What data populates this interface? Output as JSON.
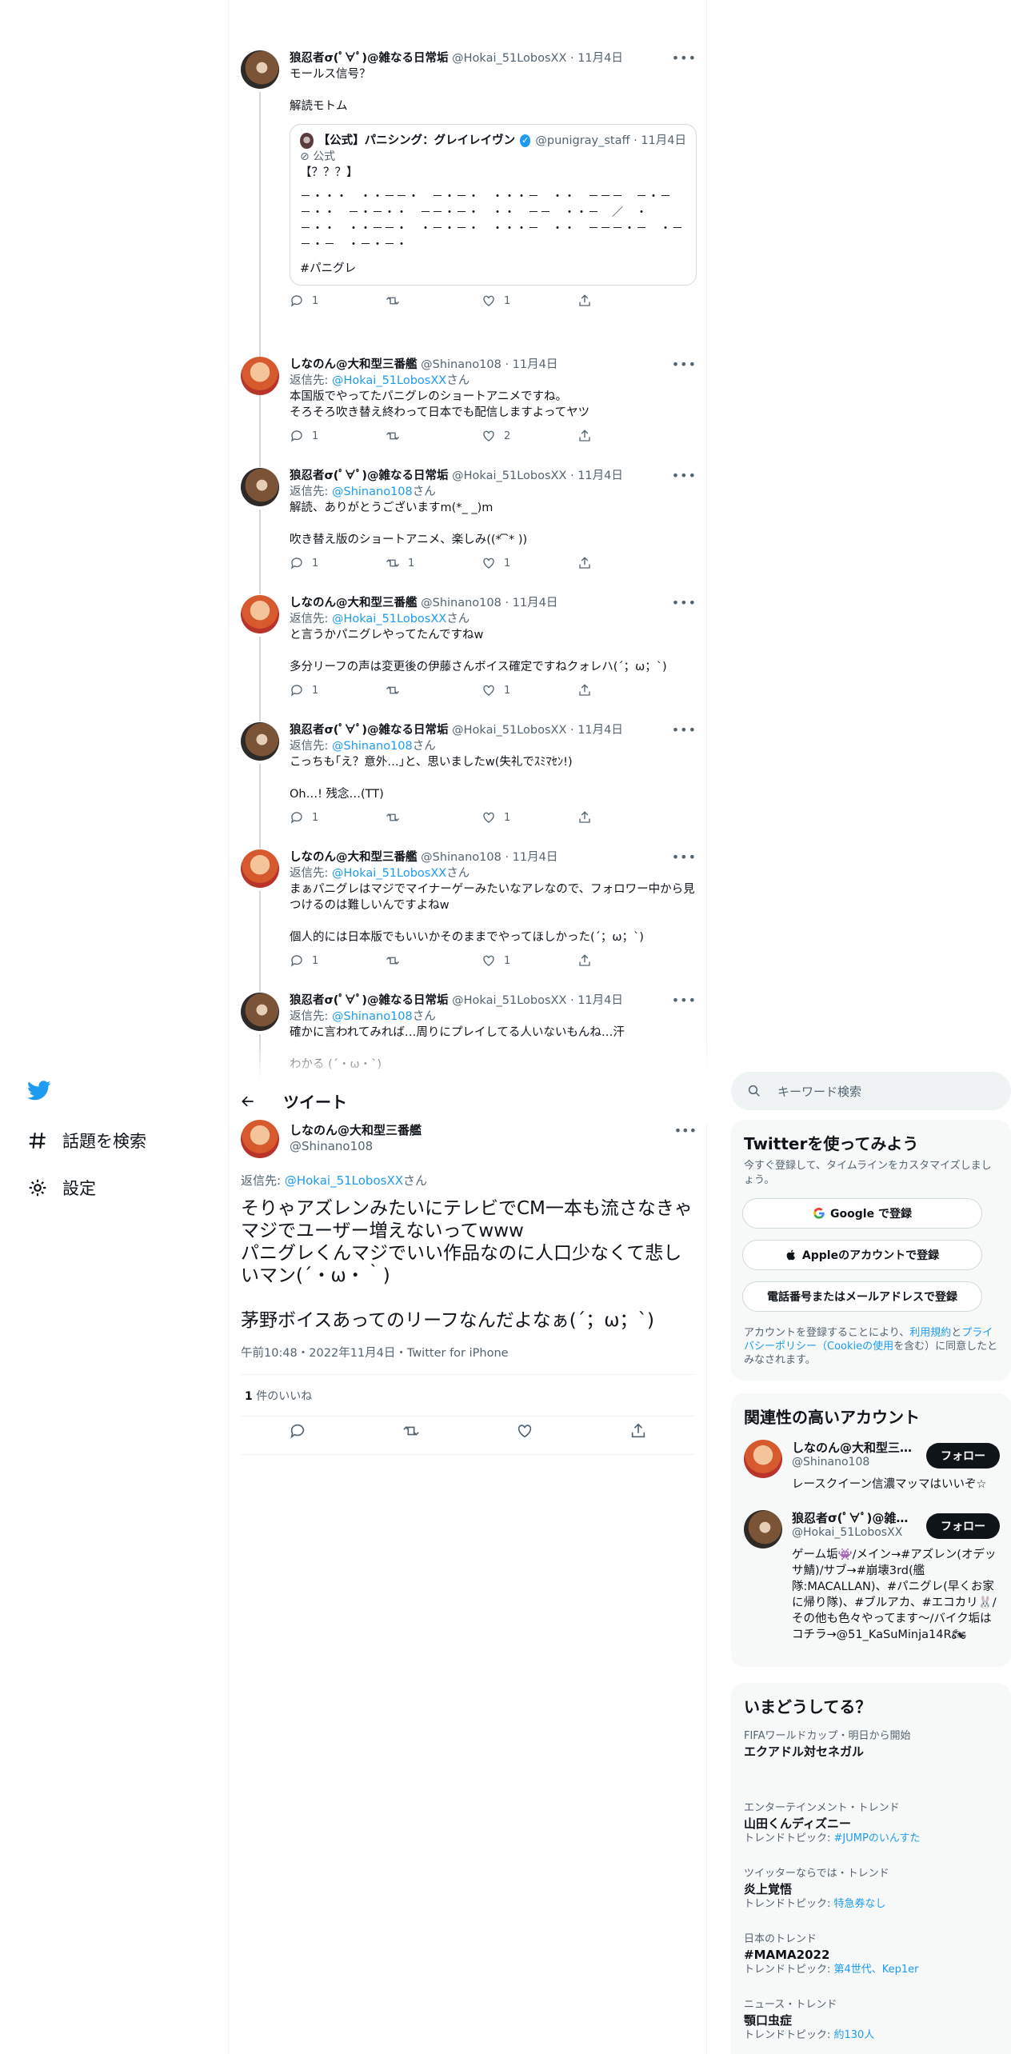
{
  "nav": {
    "explore": "話題を検索",
    "settings": "設定"
  },
  "thread": [
    {
      "name": "狼忍者σ(ﾟ∀ﾟ)@雑なる日常垢",
      "handle": "@Hokai_51LobosXX · 11月4日",
      "reply_to": "",
      "text": "モールス信号？\n\n解読モトム",
      "reply": "1",
      "retweet": "",
      "like": "1"
    },
    {
      "name": "しなのん@大和型三番艦",
      "handle": "@Shinano108 · 11月4日",
      "reply_to": "@Hokai_51LobosXX",
      "text": "本国版でやってたパニグレのショートアニメですね。\nそろそろ吹き替え終わって日本でも配信しますよってヤツ",
      "reply": "1",
      "retweet": "",
      "like": "2"
    },
    {
      "name": "狼忍者σ(ﾟ∀ﾟ)@雑なる日常垢",
      "handle": "@Hokai_51LobosXX · 11月4日",
      "reply_to": "@Shinano108",
      "text": "解読、ありがとうございますm(*_ _)m\n\n吹き替え版のショートアニメ、楽しみ((* ᷇ ᷆*  ))",
      "reply": "1",
      "retweet": "1",
      "like": "1"
    },
    {
      "name": "しなのん@大和型三番艦",
      "handle": "@Shinano108 · 11月4日",
      "reply_to": "@Hokai_51LobosXX",
      "text": "と言うかパニグレやってたんですねw\n\n多分リーフの声は変更後の伊藤さんボイス確定ですねクォレハ(´；ω；`)",
      "reply": "1",
      "retweet": "",
      "like": "1"
    },
    {
      "name": "狼忍者σ(ﾟ∀ﾟ)@雑なる日常垢",
      "handle": "@Hokai_51LobosXX · 11月4日",
      "reply_to": "@Shinano108",
      "text": "こっちも｢え？意外…｣と、思いましたw(失礼でｽﾐﾏｾﾝ!)\n\nOh…! 残念…(TT)",
      "reply": "1",
      "retweet": "",
      "like": "1"
    },
    {
      "name": "しなのん@大和型三番艦",
      "handle": "@Shinano108 · 11月4日",
      "reply_to": "@Hokai_51LobosXX",
      "text": "まぁパニグレはマジでマイナーゲーみたいなアレなので、フォロワー中から見つけるのは難しいんですよねw\n\n個人的には日本版でもいいかそのままでやってほしかった(´；ω；`)",
      "reply": "1",
      "retweet": "",
      "like": "1"
    },
    {
      "name": "狼忍者σ(ﾟ∀ﾟ)@雑なる日常垢",
      "handle": "@Hokai_51LobosXX · 11月4日",
      "reply_to": "@Shinano108",
      "text": "確かに言われてみれば…周りにプレイしてる人いないもんね…汗\n\nわかる (´・ω・`)",
      "reply": "",
      "retweet": "",
      "like": ""
    }
  ],
  "quote": {
    "name": "【公式】パニシング：グレイレイヴン",
    "handle": "@punigray_staff · 11月4日",
    "badge": "公式",
    "line1": "【？？？】",
    "morse": "－・・・　・・－－・　－・－・　・・・－　・・　－－－　－・－－・・　－・－・・　－－・－・　・・　－－　・・－　／　・－・・　・・－－・　・－・－・　・・・－　・・　－－－・－　・－－・－　・－・－・",
    "hashtag": "#パニグレ"
  },
  "header": {
    "title": "ツイート"
  },
  "main": {
    "name": "しなのん@大和型三番艦",
    "handle": "@Shinano108",
    "reply_prefix": "返信先: ",
    "reply_to": "@Hokai_51LobosXX",
    "reply_suffix": "さん",
    "text": "そりゃアズレンみたいにテレビでCM一本も流さなきゃマジでユーザー増えないってwww\nパニグレくんマジでいい作品なのに人口少なくて悲しいマン(´・ω・｀)\n\n茅野ボイスあってのリーフなんだよなぁ(´；ω；`)",
    "meta": "午前10:48・2022年11月4日・Twitter for iPhone",
    "likes_count": "1",
    "likes_label": " 件のいいね"
  },
  "reply_label": {
    "prefix": "返信先: ",
    "suffix": "さん"
  },
  "search": {
    "placeholder": "キーワード検索"
  },
  "signup": {
    "title": "Twitterを使ってみよう",
    "text": "今すぐ登録して、タイムラインをカスタマイズしましょう。",
    "google": "Google で登録",
    "apple": "Appleのアカウントで登録",
    "phone": "電話番号またはメールアドレスで登録",
    "terms_a": "アカウントを登録することにより、",
    "terms_link1": "利用規約",
    "terms_b": "と",
    "terms_link2": "プライバシーポリシー（Cookieの使用",
    "terms_c": "を含む）に同意したとみなされます。"
  },
  "related": {
    "title": "関連性の高いアカウント",
    "follow": "フォロー",
    "accounts": [
      {
        "name": "しなのん@大和型三番艦",
        "handle": "@Shinano108",
        "bio": "レースクイーン信濃マッマはいいぞ☆"
      },
      {
        "name": "狼忍者σ(ﾟ∀ﾟ)@雑なる日常垢",
        "handle": "@Hokai_51LobosXX",
        "bio": "ゲーム垢👾/メイン→#アズレン(オデッサ鯖)/サブ→#崩壊3rd(艦隊:MACALLAN)、#パニグレ(早くお家に帰り隊)、#ブルアカ、#エコカリ🐰/その他も色々やってます〜/バイク垢はコチラ→@51_KaSuMinja14R🏍"
      }
    ]
  },
  "trends": {
    "title": "いまどうしてる？",
    "items": [
      {
        "context": "FIFAワールドカップ・明日から開始",
        "name": "エクアドル対セネガル",
        "topic_prefix": "",
        "topic": ""
      },
      {
        "context": "エンターテインメント・トレンド",
        "name": "山田くんディズニー",
        "topic_prefix": "トレンドトピック: ",
        "topic": "#JUMPのいんすた"
      },
      {
        "context": "ツイッターならでは・トレンド",
        "name": "炎上覚悟",
        "topic_prefix": "トレンドトピック: ",
        "topic": "特急券なし"
      },
      {
        "context": "日本のトレンド",
        "name": "#MAMA2022",
        "topic_prefix": "トレンドトピック: ",
        "topic": "第4世代、Kep1er"
      },
      {
        "context": "ニュース・トレンド",
        "name": "顎口虫症",
        "topic_prefix": "トレンドトピック: ",
        "topic": "約130人"
      }
    ]
  },
  "colors": {
    "accent": "#1d9bf0",
    "text": "#0f1419",
    "muted": "#536471",
    "border": "#eff3f4"
  },
  "icons": [
    "twitter-bird-icon",
    "hash-icon",
    "gear-icon",
    "more-icon",
    "reply-icon",
    "retweet-icon",
    "like-icon",
    "share-icon",
    "back-arrow-icon",
    "search-icon",
    "google-icon",
    "apple-icon",
    "verified-icon"
  ]
}
